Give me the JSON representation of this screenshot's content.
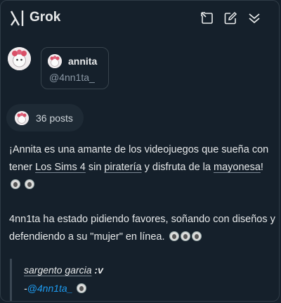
{
  "header": {
    "brand": "Grok",
    "icons": [
      "grok-logo-icon",
      "expand-icon",
      "compose-icon",
      "collapse-icon"
    ]
  },
  "profile": {
    "name": "annita",
    "handle": "@4nn1ta_"
  },
  "posts": {
    "label": "36 posts"
  },
  "bio": {
    "part1": "¡Annita es una amante de los videojuegos que sueña con tener ",
    "link1": "Los Sims 4",
    "part2": " sin ",
    "link2": "piratería",
    "part3": " y disfruta de la ",
    "link3": "mayonesa",
    "part4": "! "
  },
  "paragraph2": {
    "text": "4nn1ta ha estado pidiendo favores, soñando con diseños y defendiendo a su \"mujer\" en línea. "
  },
  "quote": {
    "author": "sargento garcia",
    "suffix": " :v",
    "dash": "-",
    "mention": "@4nn1ta_"
  },
  "colors": {
    "background": "#15202b",
    "text": "#e7e9ea",
    "muted": "#8b98a5",
    "link": "#1d9bf0"
  }
}
